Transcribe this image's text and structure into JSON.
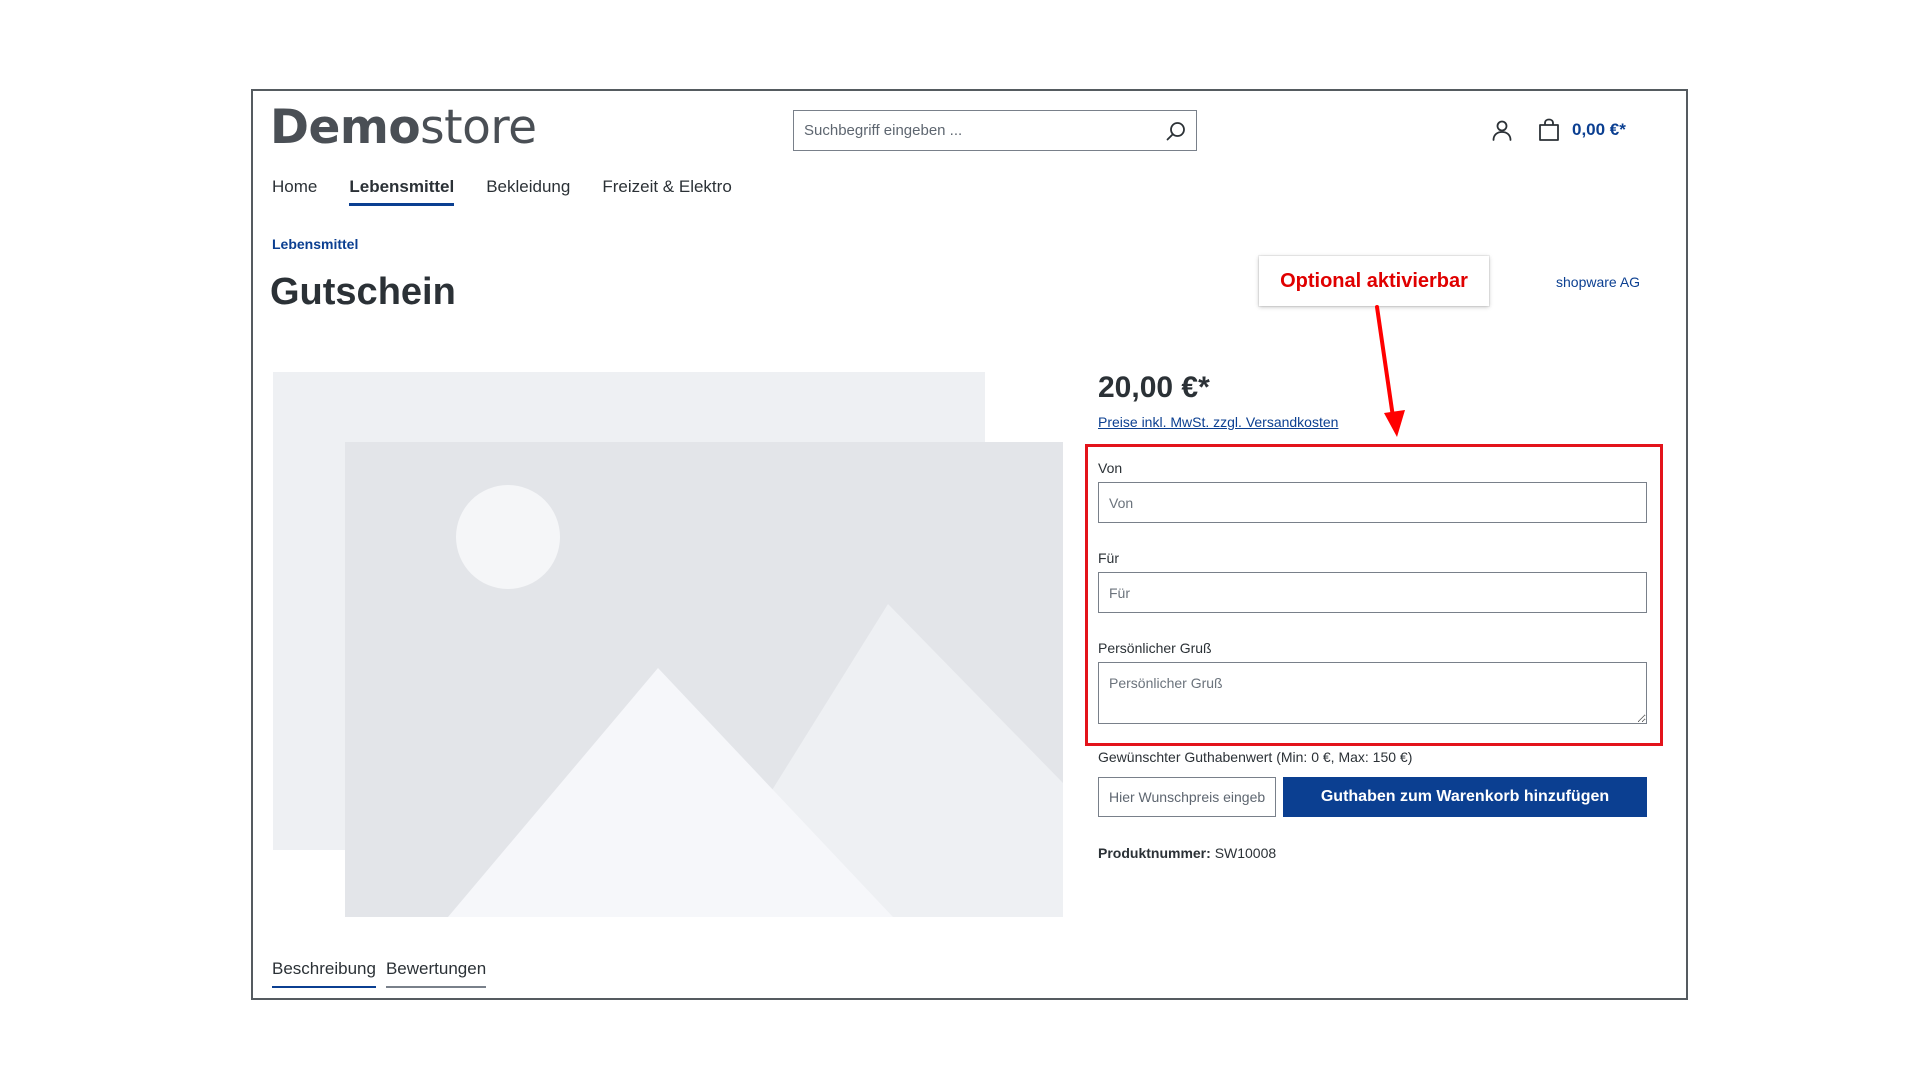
{
  "header": {
    "logo_bold": "Demo",
    "logo_light": "store",
    "search_placeholder": "Suchbegriff eingeben ...",
    "cart_total": "0,00 €*"
  },
  "nav": {
    "items": [
      {
        "label": "Home"
      },
      {
        "label": "Lebensmittel"
      },
      {
        "label": "Bekleidung"
      },
      {
        "label": "Freizeit & Elektro"
      }
    ],
    "active_index": 1
  },
  "breadcrumb": "Lebensmittel",
  "product": {
    "title": "Gutschein",
    "manufacturer": "shopware AG",
    "price": "20,00 €*",
    "tax_note": "Preise inkl. MwSt. zzgl. Versandkosten",
    "fields": {
      "from_label": "Von",
      "from_placeholder": "Von",
      "to_label": "Für",
      "to_placeholder": "Für",
      "greeting_label": "Persönlicher Gruß",
      "greeting_placeholder": "Persönlicher Gruß"
    },
    "value_label": "Gewünschter Guthabenwert (Min: 0 €, Max: 150 €)",
    "value_placeholder": "Hier Wunschpreis eingeben",
    "add_to_cart_label": "Guthaben zum Warenkorb hinzufügen",
    "product_number_label": "Produktnummer:",
    "product_number": "SW10008"
  },
  "annotation": {
    "text": "Optional aktivierbar"
  },
  "tabs": [
    {
      "label": "Beschreibung"
    },
    {
      "label": "Bewertungen"
    }
  ],
  "colors": {
    "primary": "#0b3f91",
    "annotation": "#e3131b",
    "text": "#2b3136"
  }
}
